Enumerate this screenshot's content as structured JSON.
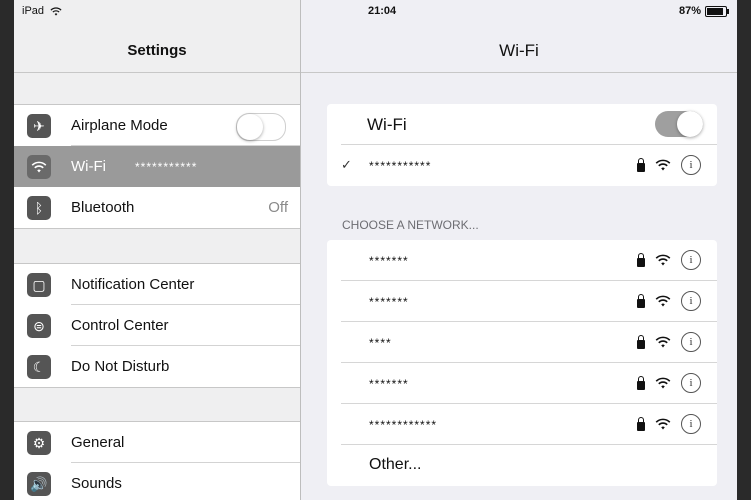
{
  "status_bar": {
    "device": "iPad",
    "time": "21:04",
    "battery": "87%"
  },
  "settings": {
    "title": "Settings",
    "groups": [
      [
        {
          "label": "Airplane Mode",
          "icon": "airplane-icon",
          "accessory": "toggle-off"
        },
        {
          "label": "Wi-Fi",
          "icon": "wifi-icon",
          "detail": "***********",
          "selected": true
        },
        {
          "label": "Bluetooth",
          "icon": "bluetooth-icon",
          "detail": "Off"
        }
      ],
      [
        {
          "label": "Notification Center",
          "icon": "notification-icon"
        },
        {
          "label": "Control Center",
          "icon": "control-center-icon"
        },
        {
          "label": "Do Not Disturb",
          "icon": "moon-icon"
        }
      ],
      [
        {
          "label": "General",
          "icon": "gear-icon"
        },
        {
          "label": "Sounds",
          "icon": "speaker-icon"
        }
      ]
    ]
  },
  "wifi_pane": {
    "title": "Wi-Fi",
    "wifi_label": "Wi-Fi",
    "wifi_on": true,
    "connected_network": "***********",
    "choose_label": "CHOOSE A NETWORK...",
    "networks": [
      "*******",
      "*******",
      "****",
      "*******",
      "************"
    ],
    "other_label": "Other..."
  },
  "colors": {
    "selected_row": "#9a9a9a",
    "toggle_on": "#9f9f9f"
  }
}
